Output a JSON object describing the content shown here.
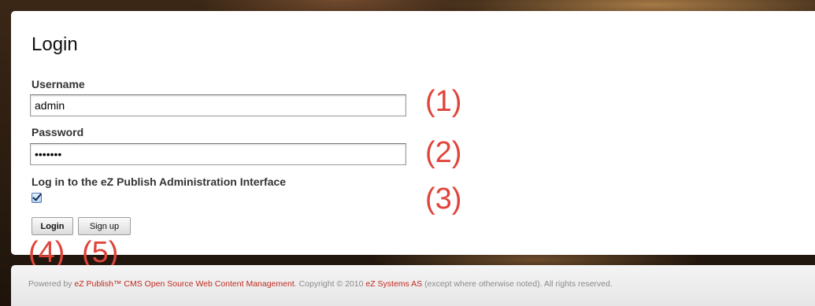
{
  "login": {
    "title": "Login",
    "username_label": "Username",
    "username_value": "admin",
    "password_label": "Password",
    "password_value": "admin12",
    "admin_checkbox_label": "Log in to the eZ Publish Administration Interface",
    "admin_checkbox_checked": true,
    "login_button": "Login",
    "signup_button": "Sign up"
  },
  "annotations": {
    "a1": "(1)",
    "a2": "(2)",
    "a3": "(3)",
    "a4": "(4)",
    "a5": "(5)",
    "color": "#e0443b"
  },
  "footer": {
    "prefix": "Powered by ",
    "product_link": "eZ Publish™ CMS Open Source Web Content Management",
    "mid": ". Copyright © 2010 ",
    "company_link": "eZ Systems AS",
    "suffix": " (except where otherwise noted). All rights reserved.",
    "link_color": "#c0291f"
  }
}
